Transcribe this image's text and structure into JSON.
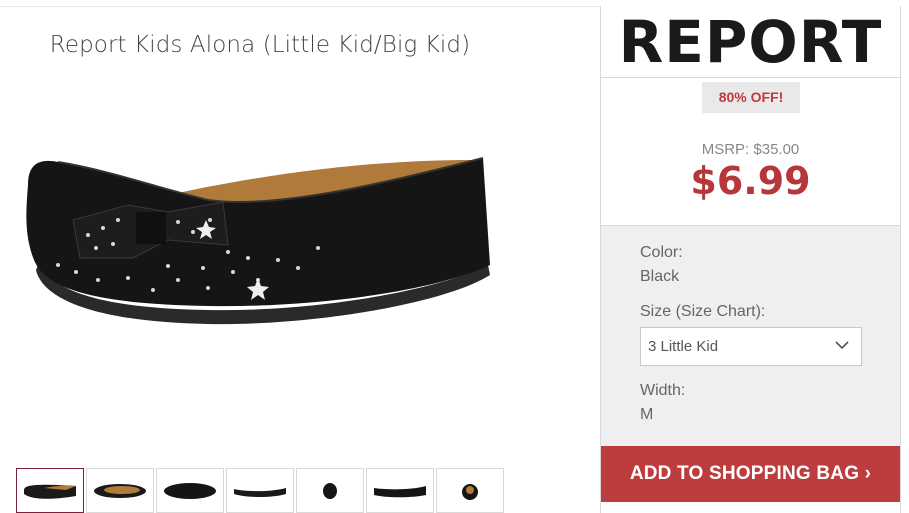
{
  "product": {
    "title": "Report Kids Alona (Little Kid/Big Kid)",
    "brand": "REPORT",
    "discount_badge": "80% OFF!",
    "msrp": "MSRP: $35.00",
    "price": "$6.99"
  },
  "options": {
    "color_label": "Color:",
    "color_value": "Black",
    "size_label": "Size (Size Chart):",
    "size_selected": "3 Little Kid",
    "width_label": "Width:",
    "width_value": "M"
  },
  "cta": {
    "label": "ADD TO SHOPPING BAG ›"
  },
  "icons": {
    "size_dropdown": "chevron-down-icon"
  },
  "colors": {
    "price_red": "#b7363b",
    "cta_red": "#bd3d3e",
    "badge_bg": "#e9e9e9"
  }
}
